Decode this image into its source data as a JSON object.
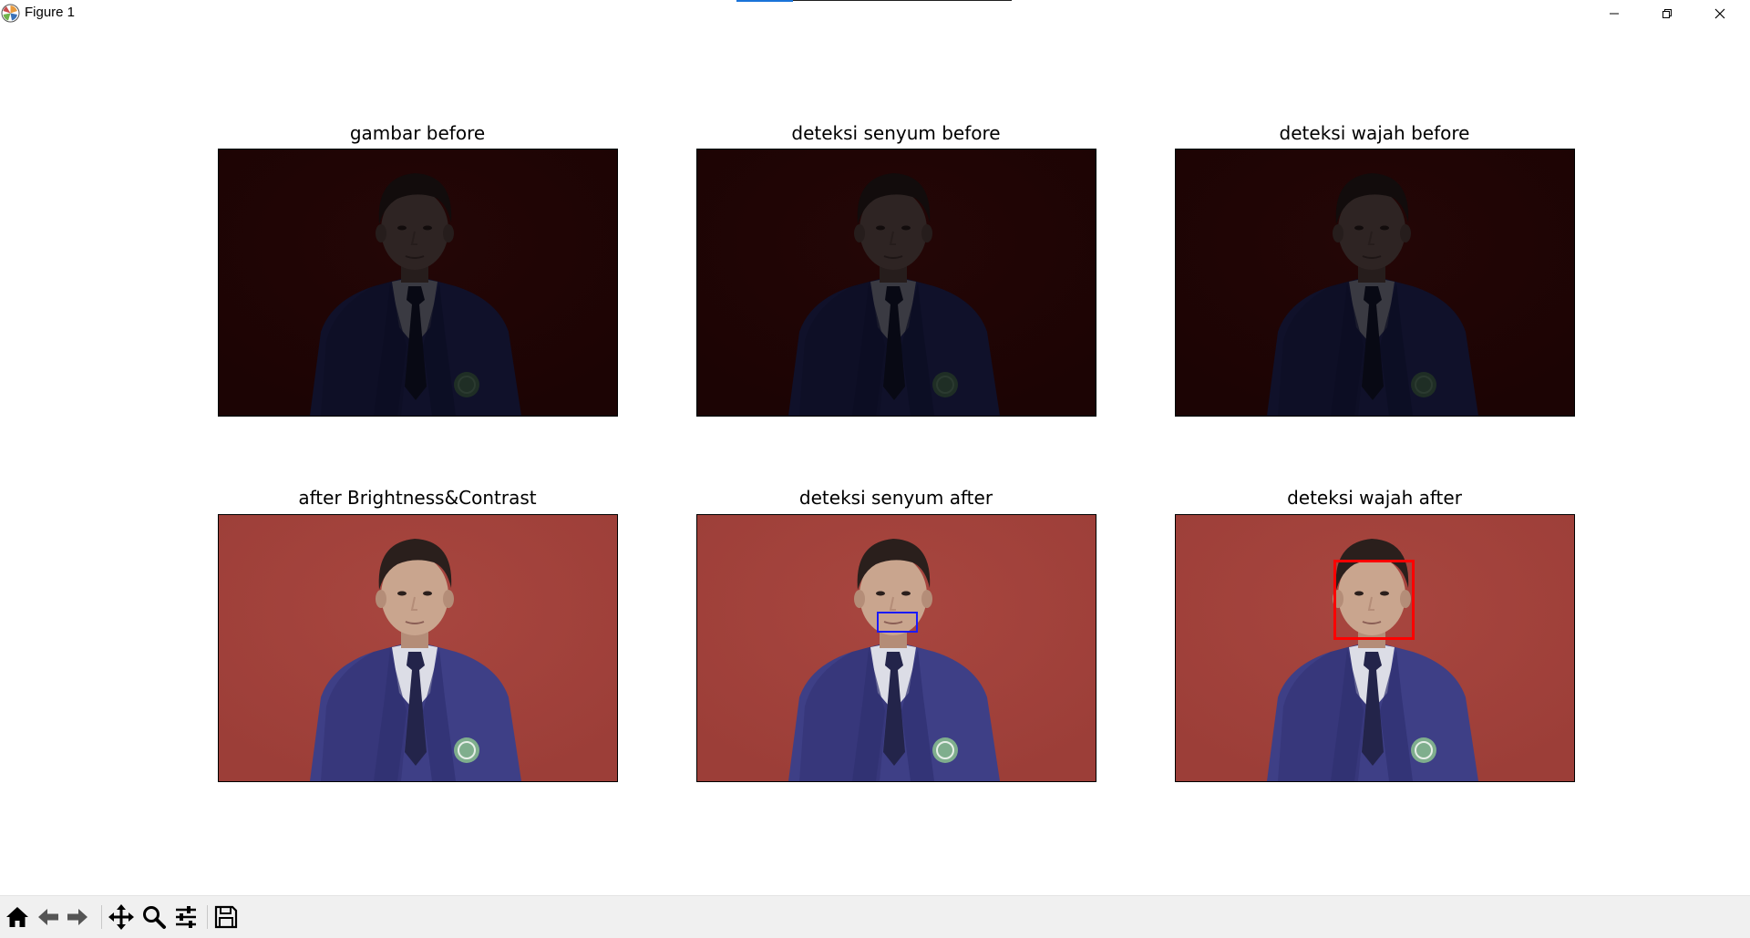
{
  "window": {
    "title": "Figure 1",
    "controls": [
      "minimize-icon",
      "maximize-icon",
      "close-icon"
    ]
  },
  "figure": {
    "subplots": [
      {
        "title": "gambar before",
        "variant": "before",
        "detection": "none"
      },
      {
        "title": "deteksi senyum before",
        "variant": "before",
        "detection": "none"
      },
      {
        "title": "deteksi wajah before",
        "variant": "before",
        "detection": "none"
      },
      {
        "title": "after Brightness&Contrast",
        "variant": "after",
        "detection": "none"
      },
      {
        "title": "deteksi senyum after",
        "variant": "after",
        "detection": "smile",
        "box_color": "#1a1aff"
      },
      {
        "title": "deteksi wajah after",
        "variant": "after",
        "detection": "face",
        "box_color": "#ff0000"
      }
    ]
  },
  "colors": {
    "before_background": "#240606",
    "after_background": "#a8463f",
    "smile_box": "#1a1aff",
    "face_box": "#ff0000"
  },
  "toolbar": {
    "buttons": [
      "home-icon",
      "back-icon",
      "forward-icon",
      "pan-icon",
      "zoom-icon",
      "configure-subplots-icon",
      "save-icon"
    ]
  }
}
